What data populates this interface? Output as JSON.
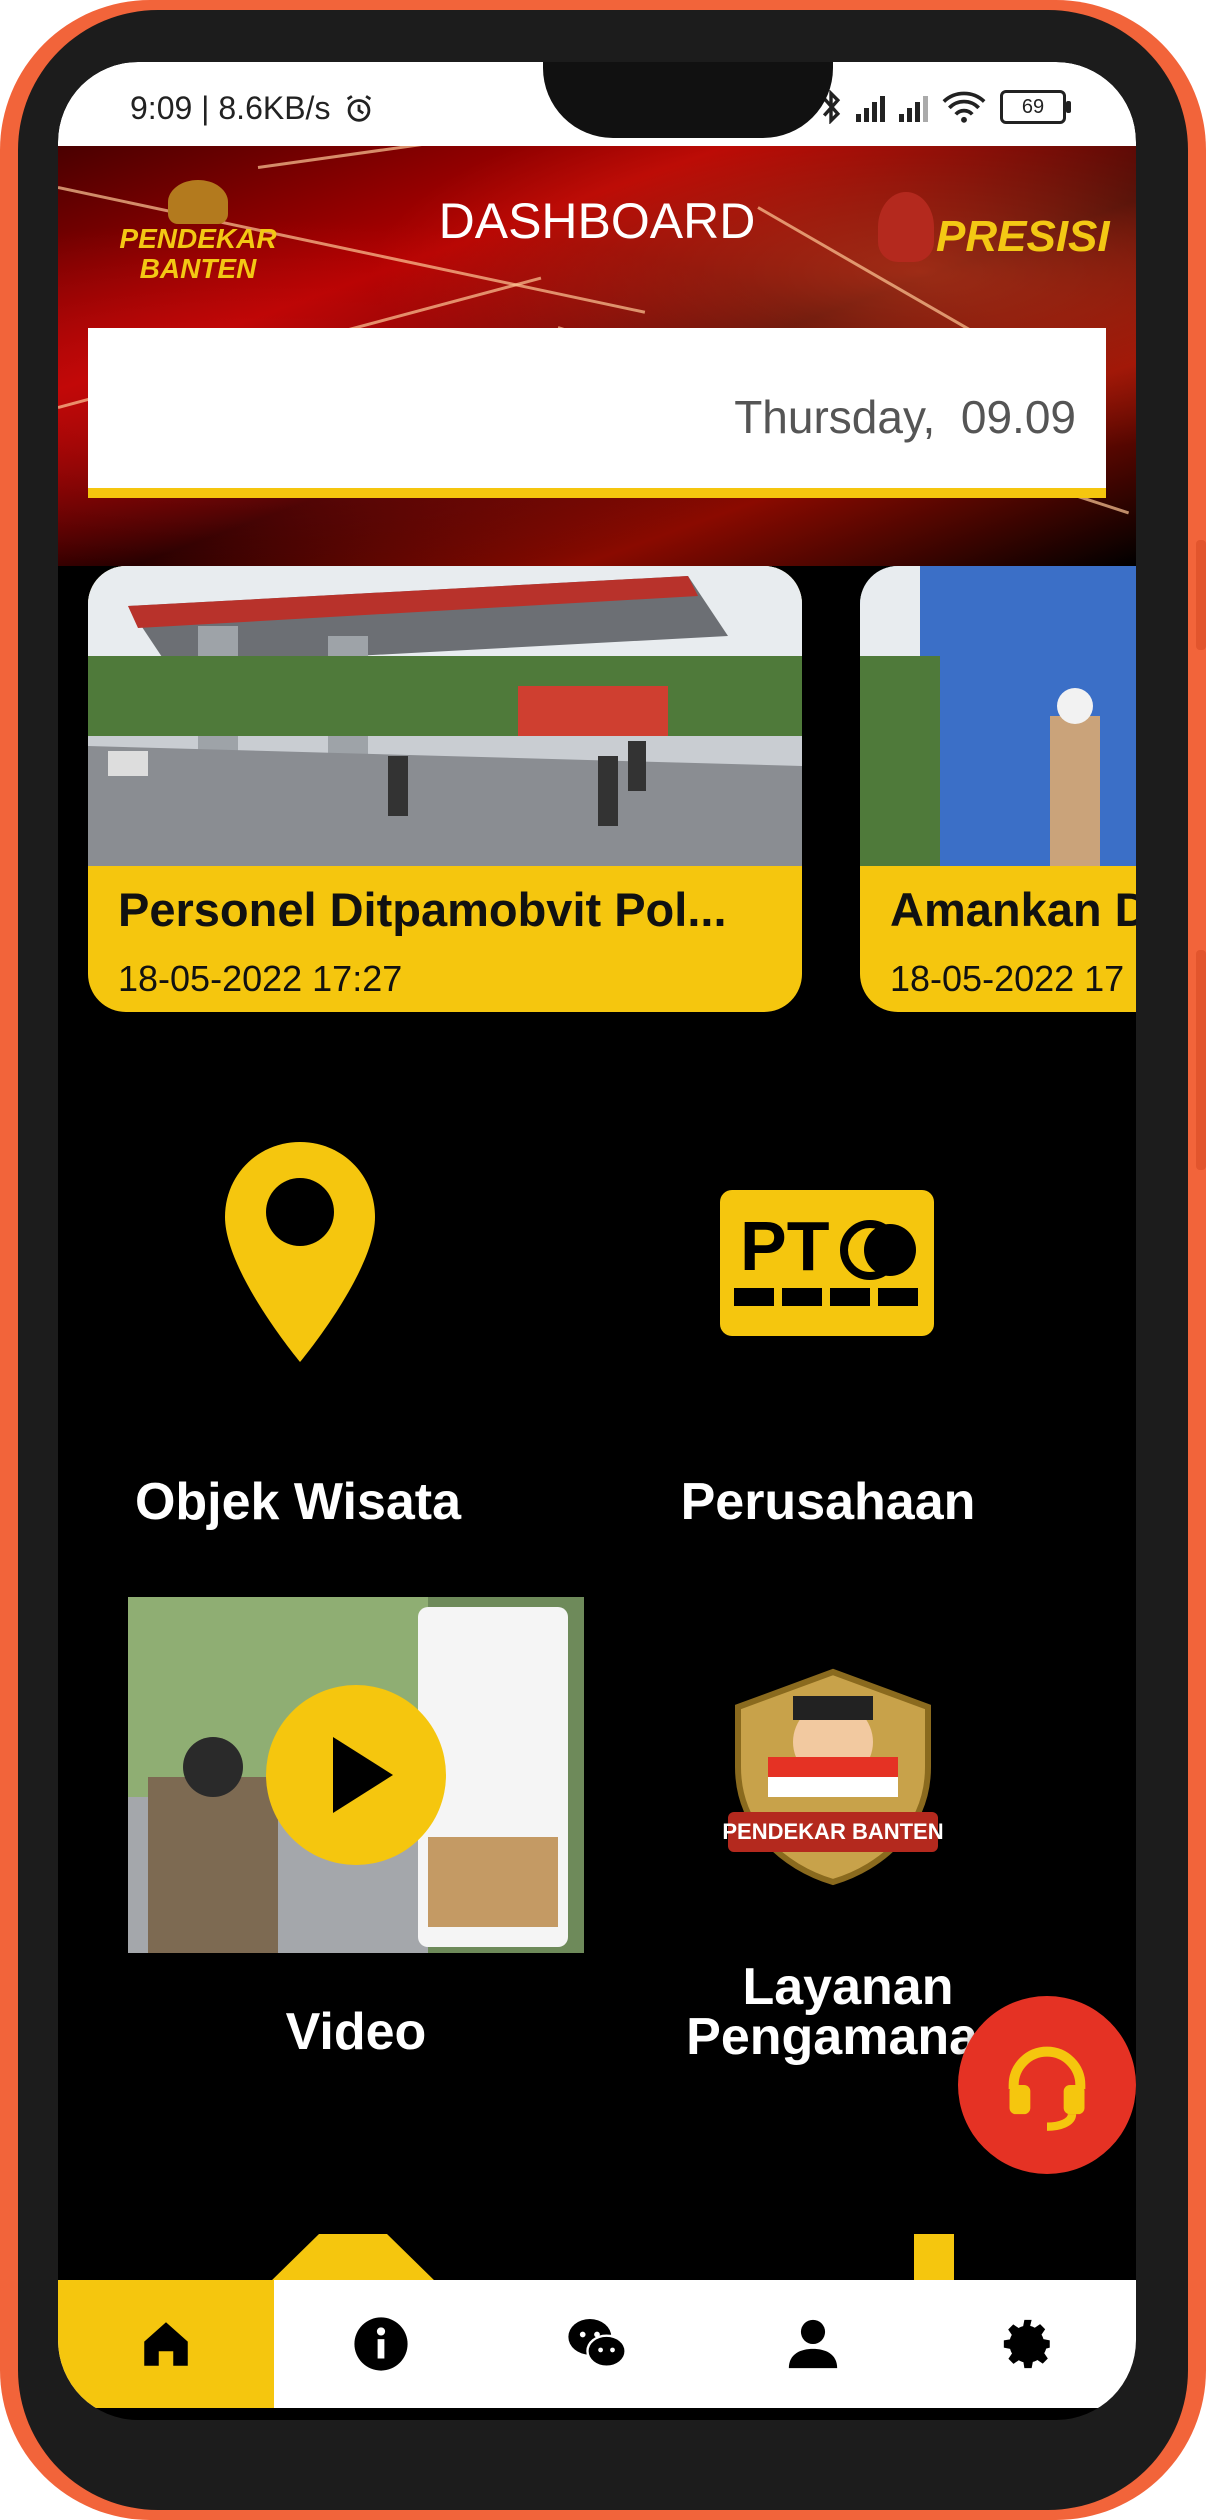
{
  "status_bar": {
    "time_speed": "9:09 | 8.6KB/s",
    "battery": "69"
  },
  "header": {
    "title": "DASHBOARD",
    "left_logo_text": "PENDEKAR BANTEN",
    "right_logo_text": "PRESISI"
  },
  "date_card": {
    "text": "Thursday,  09.09"
  },
  "news": [
    {
      "title": "Personel Ditpamobvit Pol...",
      "date": "18-05-2022 17:27"
    },
    {
      "title": "Amankan D",
      "date": "18-05-2022 17"
    }
  ],
  "menu": [
    {
      "label": "Objek Wisata",
      "icon": "map-pin-icon"
    },
    {
      "label": "Perusahaan",
      "icon": "pt-card-icon"
    },
    {
      "label": "Video",
      "icon": "video-thumbnail"
    },
    {
      "label_line1": "Layanan",
      "label_line2": "Pengamanan",
      "icon": "pendekar-banten-logo"
    }
  ],
  "fab": {
    "icon": "headset-icon"
  },
  "bottom_nav": [
    {
      "name": "home",
      "icon": "home-icon",
      "active": true
    },
    {
      "name": "info",
      "icon": "info-icon",
      "active": false
    },
    {
      "name": "chat",
      "icon": "wechat-icon",
      "active": false
    },
    {
      "name": "profile",
      "icon": "person-icon",
      "active": false
    },
    {
      "name": "settings",
      "icon": "gear-icon",
      "active": false
    }
  ],
  "colors": {
    "accent": "#f5c60e",
    "fab": "#e53224",
    "frame": "#f2643a"
  }
}
